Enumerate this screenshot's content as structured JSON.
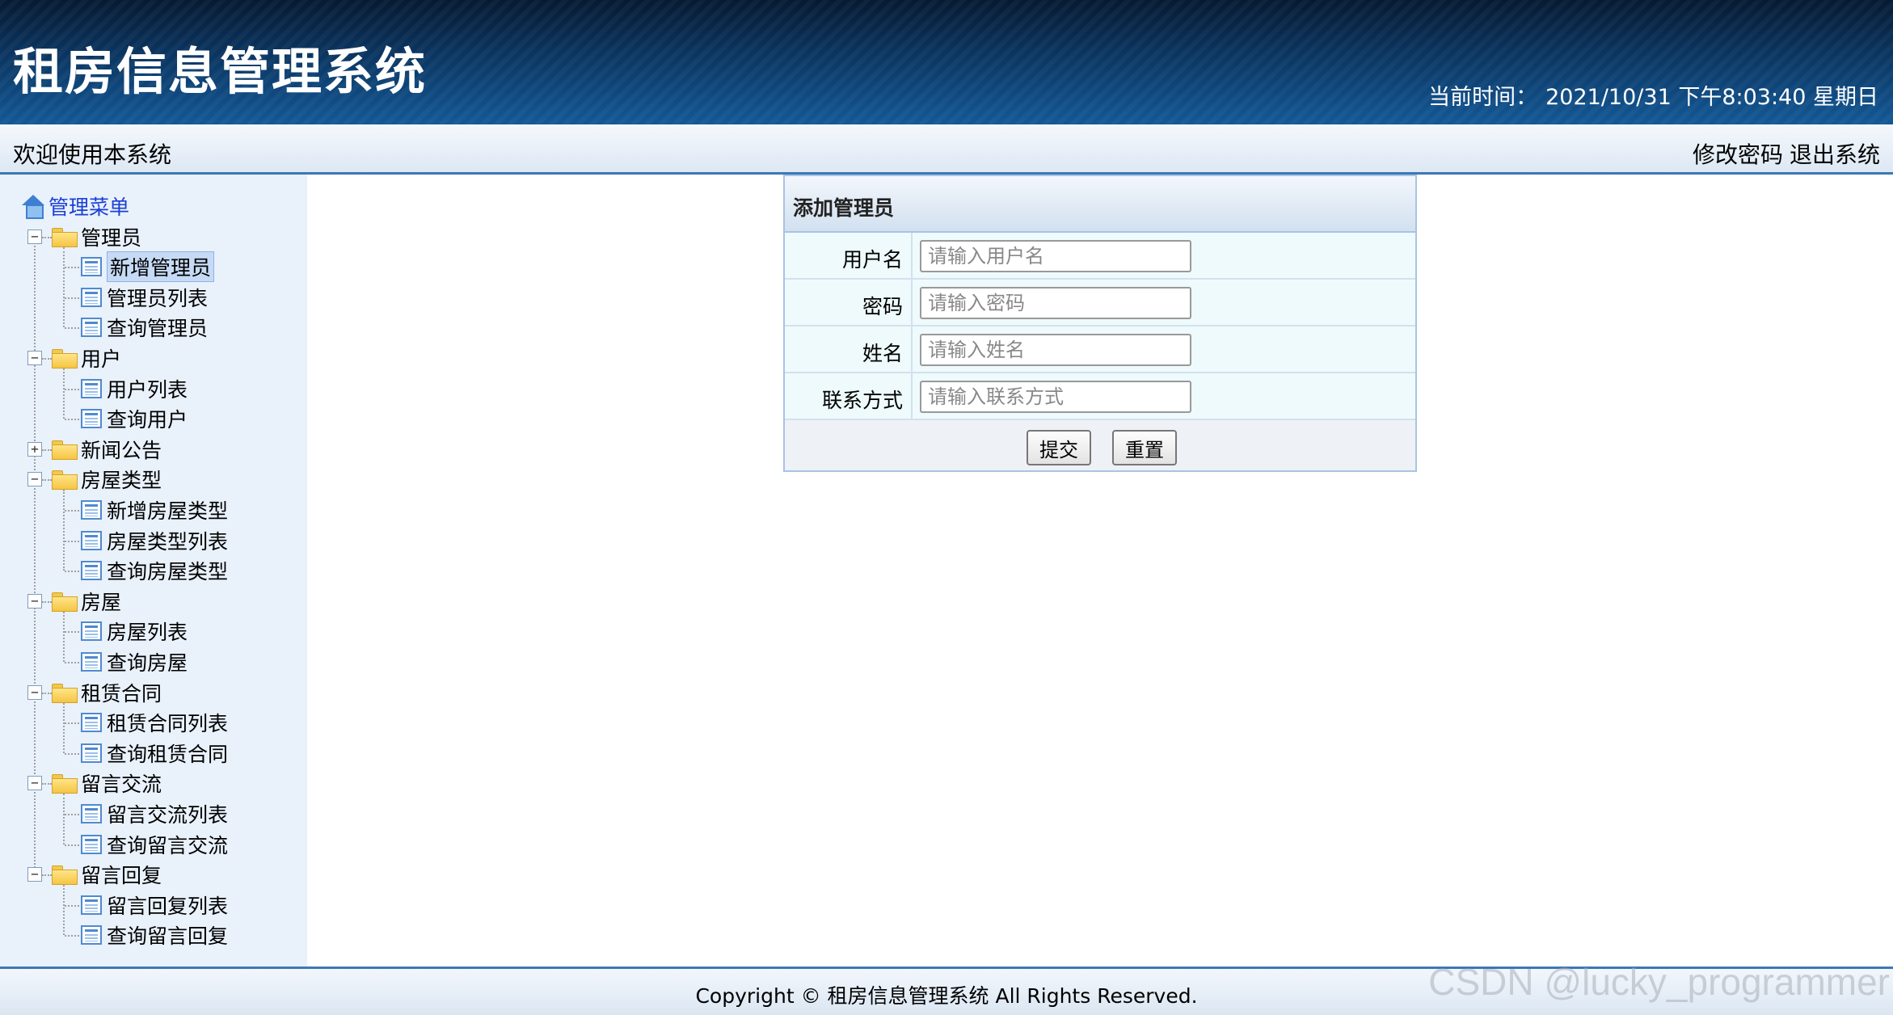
{
  "header": {
    "title": "租房信息管理系统",
    "time_label": "当前时间：",
    "time_value": "2021/10/31 下午8:03:40 星期日"
  },
  "subbar": {
    "welcome": "欢迎使用本系统",
    "change_password": "修改密码",
    "logout": "退出系统"
  },
  "sidebar": {
    "root": "管理菜单",
    "groups": [
      {
        "label": "管理员",
        "expanded": true,
        "items": [
          "新增管理员",
          "管理员列表",
          "查询管理员"
        ]
      },
      {
        "label": "用户",
        "expanded": true,
        "items": [
          "用户列表",
          "查询用户"
        ]
      },
      {
        "label": "新闻公告",
        "expanded": false,
        "items": []
      },
      {
        "label": "房屋类型",
        "expanded": true,
        "items": [
          "新增房屋类型",
          "房屋类型列表",
          "查询房屋类型"
        ]
      },
      {
        "label": "房屋",
        "expanded": true,
        "items": [
          "房屋列表",
          "查询房屋"
        ]
      },
      {
        "label": "租赁合同",
        "expanded": true,
        "items": [
          "租赁合同列表",
          "查询租赁合同"
        ]
      },
      {
        "label": "留言交流",
        "expanded": true,
        "items": [
          "留言交流列表",
          "查询留言交流"
        ]
      },
      {
        "label": "留言回复",
        "expanded": true,
        "items": [
          "留言回复列表",
          "查询留言回复"
        ]
      }
    ],
    "selected": "新增管理员"
  },
  "form": {
    "caption": "添加管理员",
    "fields": [
      {
        "label": "用户名",
        "placeholder": "请输入用户名",
        "value": ""
      },
      {
        "label": "密码",
        "placeholder": "请输入密码",
        "value": ""
      },
      {
        "label": "姓名",
        "placeholder": "请输入姓名",
        "value": ""
      },
      {
        "label": "联系方式",
        "placeholder": "请输入联系方式",
        "value": ""
      }
    ],
    "submit_label": "提交",
    "reset_label": "重置"
  },
  "footer": {
    "copyright": "Copyright © 租房信息管理系统 All Rights Reserved."
  },
  "watermark": "CSDN @lucky_programmer"
}
